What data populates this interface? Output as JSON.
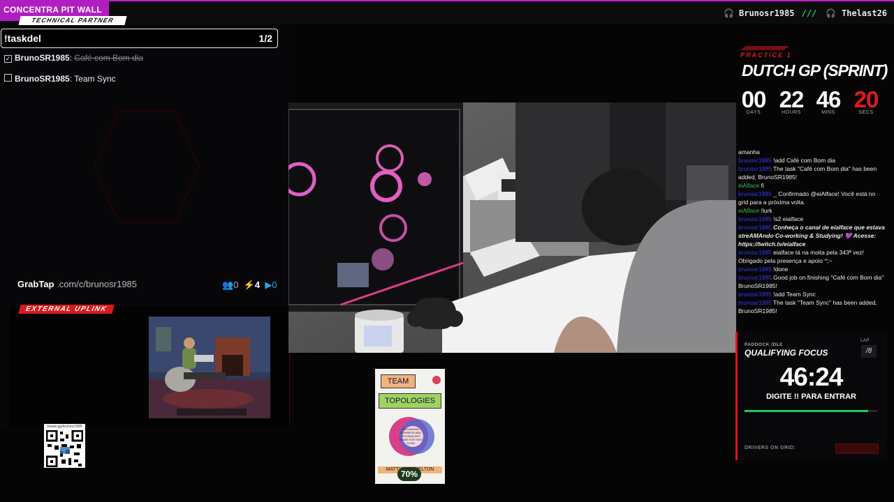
{
  "topbar": {
    "brand": "CONCENTRA PIT WALL",
    "technical_partner": "TECHNICAL PARTNER",
    "host1": "Brunosr1985",
    "separator": "///",
    "host2": "Thelast26"
  },
  "tasks": {
    "command": "!taskdel",
    "count": "1/2",
    "items": [
      {
        "user": "BrunoSR1985",
        "text": "Café com Bom dia",
        "done": true,
        "check": "✓"
      },
      {
        "user": "BrunoSR1985",
        "text": "Team Sync",
        "done": false,
        "check": ""
      }
    ]
  },
  "grabtap": {
    "logo": "GrabTap",
    "url": ".com/c/brunosr1985",
    "stat_people": "0",
    "stat_bolt": "4",
    "stat_play": "0"
  },
  "external_uplink": "EXTERNAL UPLINK",
  "race": {
    "session": "PRACTICE 1",
    "title": "DUTCH GP (SPRINT)",
    "countdown": [
      {
        "value": "00",
        "label": "DAYS",
        "color": "#ffffff"
      },
      {
        "value": "22",
        "label": "HOURS",
        "color": "#ffffff"
      },
      {
        "value": "46",
        "label": "MINS",
        "color": "#ffffff"
      },
      {
        "value": "20",
        "label": "SECS",
        "color": "#e01a1a"
      }
    ]
  },
  "chat": [
    {
      "user": "",
      "text": "amanha"
    },
    {
      "user": "brunosr1985",
      "text": "!add Café com Bom dia"
    },
    {
      "user": "brunosr1985",
      "text": "The task \"Café com Bom dia\" has been added, BrunoSR1985!"
    },
    {
      "user": "eiAlface",
      "text": "fi",
      "green": true
    },
    {
      "user": "brunosr1985",
      "text": "_ Confirmado @eiAlface! Você está no grid para a próxima volta."
    },
    {
      "user": "eiAlface",
      "text": "!lurk",
      "green": true
    },
    {
      "user": "brunosr1985",
      "text": "!s2 eialface"
    },
    {
      "user": "brunosr1985",
      "text": "Conheça o canal de eialface que estava streAMAndo Co-working & Studying! 💜 Acesse: https://twitch.tv/eialface",
      "italic": true
    },
    {
      "user": "brunosr1985",
      "text": "eialface tá na moita pela 343ª vez! Obrigado pela presença e apoio ^;~"
    },
    {
      "user": "brunosr1985",
      "text": "!done"
    },
    {
      "user": "brunosr1985",
      "text": "Good job on finishing \"Café com Bom dia\" BrunoSR1985!"
    },
    {
      "user": "brunosr1985",
      "text": "!add Team Sync"
    },
    {
      "user": "brunosr1985",
      "text": "The task \"Team Sync\" has been added, BrunoSR1985!"
    }
  ],
  "focus": {
    "paddock": "PADDOCK IDLE",
    "title": "QUALIFYING FOCUS",
    "lap_label": "LAP",
    "lap_value": "/8",
    "timer": "46:24",
    "instruction": "DIGITE !! PARA ENTRAR",
    "progress": 0.93,
    "drivers_label": "DRIVERS ON GRID:"
  },
  "qr": {
    "label": "livepix.gg/brunosr1985"
  },
  "book": {
    "title1": "TEAM",
    "title2": "TOPOLOGIES",
    "subtitle": "ORGANIZING BUSINESS AND TECHNOLOGY TEAMS FOR FAST FLOW",
    "author": "MATTHEW SKELTON",
    "progress": "70%"
  }
}
